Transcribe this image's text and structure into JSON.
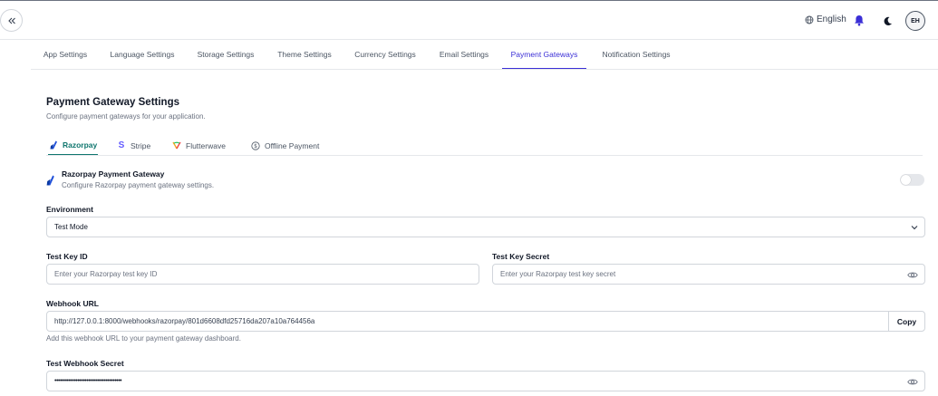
{
  "topbar": {
    "language": "English",
    "avatar_initials": "EH",
    "accent_color": "#3b2fd6"
  },
  "settings_tabs": [
    {
      "label": "App Settings",
      "active": false
    },
    {
      "label": "Language Settings",
      "active": false
    },
    {
      "label": "Storage Settings",
      "active": false
    },
    {
      "label": "Theme Settings",
      "active": false
    },
    {
      "label": "Currency Settings",
      "active": false
    },
    {
      "label": "Email Settings",
      "active": false
    },
    {
      "label": "Payment Gateways",
      "active": true
    },
    {
      "label": "Notification Settings",
      "active": false
    }
  ],
  "section": {
    "title": "Payment Gateway Settings",
    "subtitle": "Configure payment gateways for your application."
  },
  "gateway_tabs": [
    {
      "label": "Razorpay",
      "icon": "razorpay-icon",
      "active": true
    },
    {
      "label": "Stripe",
      "icon": "stripe-icon",
      "active": false
    },
    {
      "label": "Flutterwave",
      "icon": "flutterwave-icon",
      "active": false
    },
    {
      "label": "Offline Payment",
      "icon": "dollar-circle-icon",
      "active": false
    }
  ],
  "razorpay": {
    "title": "Razorpay Payment Gateway",
    "subtitle": "Configure Razorpay payment gateway settings.",
    "enabled": false,
    "environment_label": "Environment",
    "environment_value": "Test Mode",
    "test_key_id_label": "Test Key ID",
    "test_key_id_placeholder": "Enter your Razorpay test key ID",
    "test_key_secret_label": "Test Key Secret",
    "test_key_secret_placeholder": "Enter your Razorpay test key secret",
    "webhook_url_label": "Webhook URL",
    "webhook_url_value": "http://127.0.0.1:8000/webhooks/razorpay/801d6608dfd25716da207a10a764456a",
    "copy_label": "Copy",
    "webhook_help": "Add this webhook URL to your payment gateway dashboard.",
    "test_webhook_secret_label": "Test Webhook Secret",
    "test_webhook_secret_value": "••••••••••••••••••••••••••••••••••••••"
  }
}
